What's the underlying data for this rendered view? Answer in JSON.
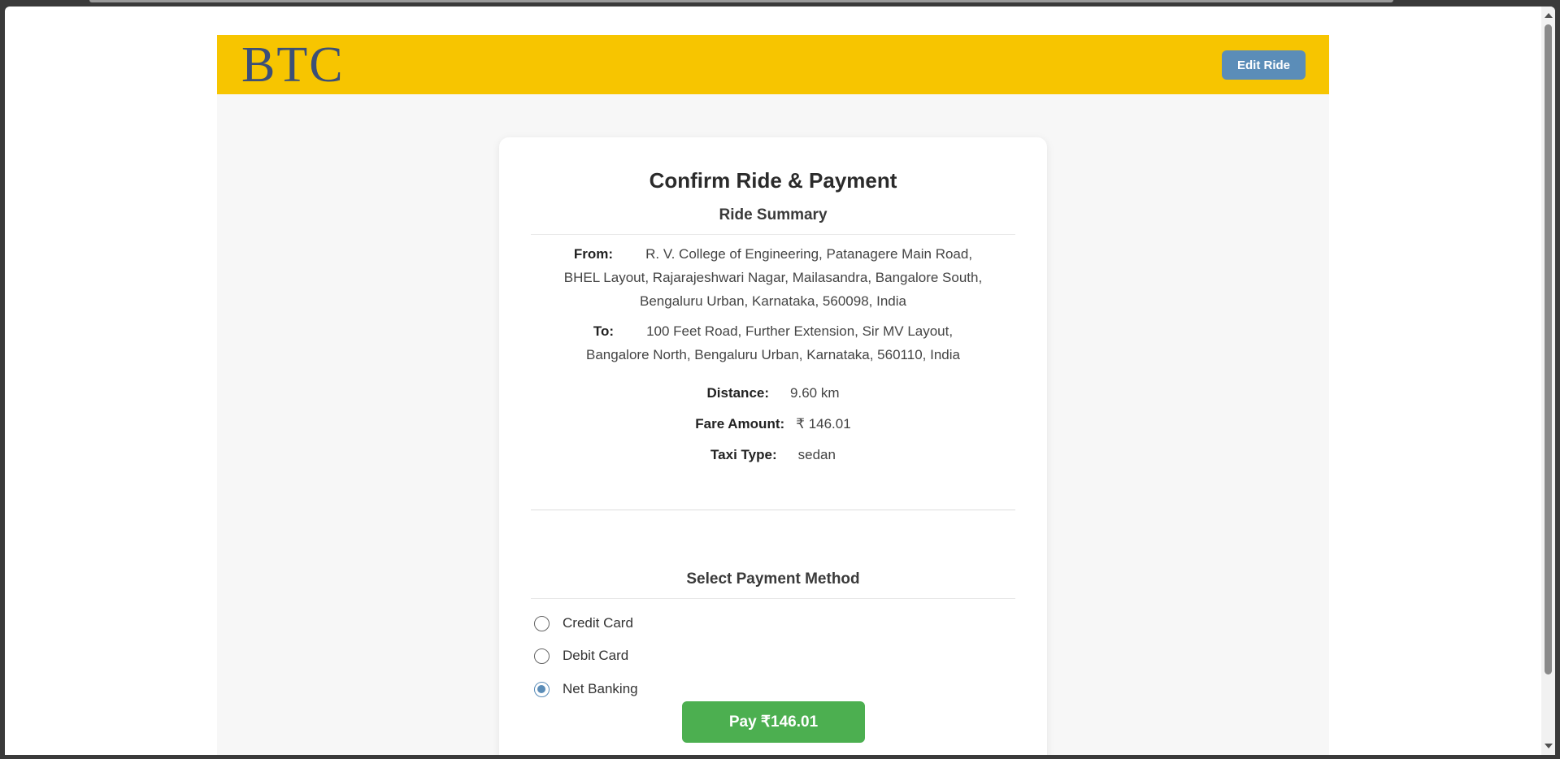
{
  "header": {
    "logo_text": "BTC",
    "edit_ride_label": "Edit Ride"
  },
  "card": {
    "title": "Confirm Ride & Payment",
    "ride_summary_title": "Ride Summary",
    "from_label": "From:",
    "from_value_line1": "R. V. College of Engineering, Patanagere Main Road,",
    "from_value_line2": "BHEL Layout, Rajarajeshwari Nagar, Mailasandra, Bangalore South,",
    "from_value_line3": "Bengaluru Urban, Karnataka, 560098, India",
    "to_label": "To:",
    "to_value_line1": "100 Feet Road, Further Extension, Sir MV Layout,",
    "to_value_line2": "Bangalore North, Bengaluru Urban, Karnataka, 560110, India",
    "distance_label": "Distance:",
    "distance_value": "9.60 km",
    "fare_label": "Fare Amount:",
    "fare_value": "₹ 146.01",
    "taxi_label": "Taxi Type:",
    "taxi_value": "sedan",
    "payment_title": "Select Payment Method",
    "payment_options": [
      {
        "label": "Credit Card",
        "selected": false
      },
      {
        "label": "Debit Card",
        "selected": false
      },
      {
        "label": "Net Banking",
        "selected": true
      }
    ],
    "pay_button_label": "Pay ₹146.01"
  },
  "colors": {
    "header_bg": "#f7c500",
    "logo": "#3b4f78",
    "edit_button": "#5b8db8",
    "pay_button": "#4caf50",
    "radio_selected": "#5b8db8"
  }
}
